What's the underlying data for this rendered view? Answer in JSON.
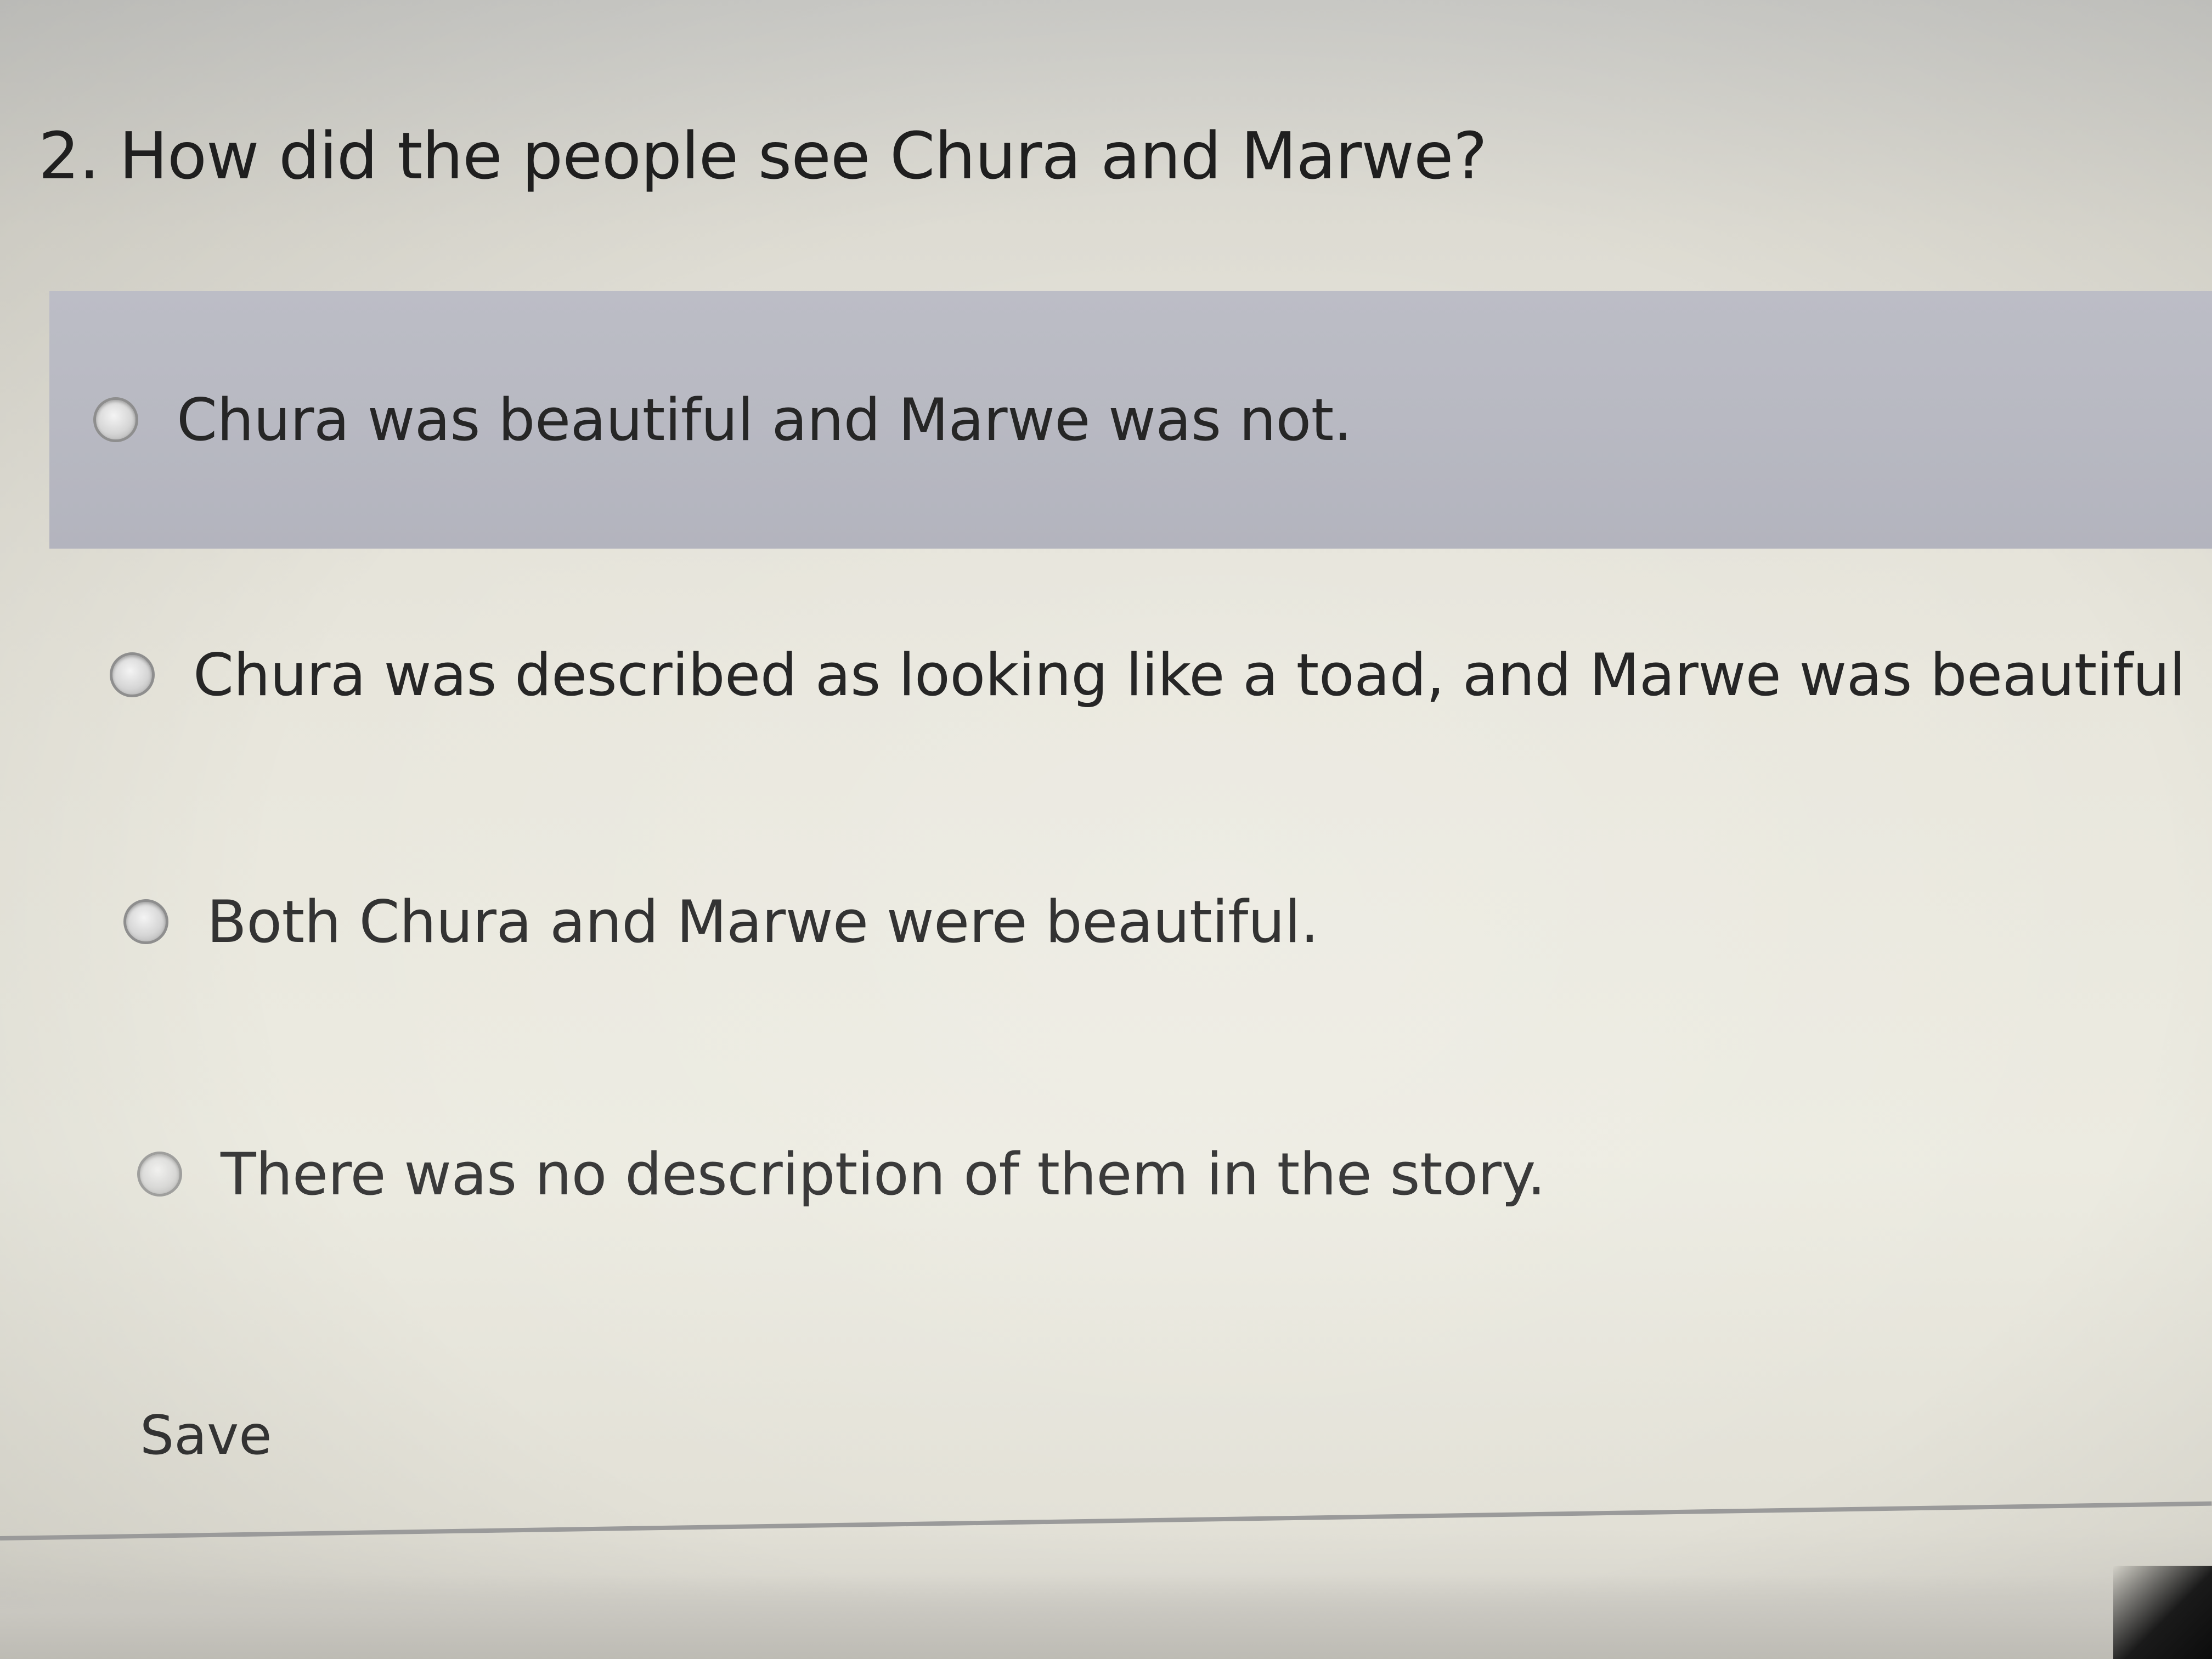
{
  "question": {
    "title": "2. How did the people see Chura and Marwe?"
  },
  "options": [
    {
      "label": "Chura was beautiful and Marwe was not.",
      "selected": false,
      "highlighted": true
    },
    {
      "label": "Chura was described as looking like a toad, and Marwe was beautiful",
      "selected": false,
      "highlighted": false
    },
    {
      "label": "Both Chura and Marwe were beautiful.",
      "selected": false,
      "highlighted": false
    },
    {
      "label": "There was no description of them in the story.",
      "selected": false,
      "highlighted": false
    }
  ],
  "actions": {
    "save_label": "Save"
  },
  "colors": {
    "highlight_row": "#b8b9c2",
    "background": "#e8e6dc",
    "text": "#262626"
  }
}
